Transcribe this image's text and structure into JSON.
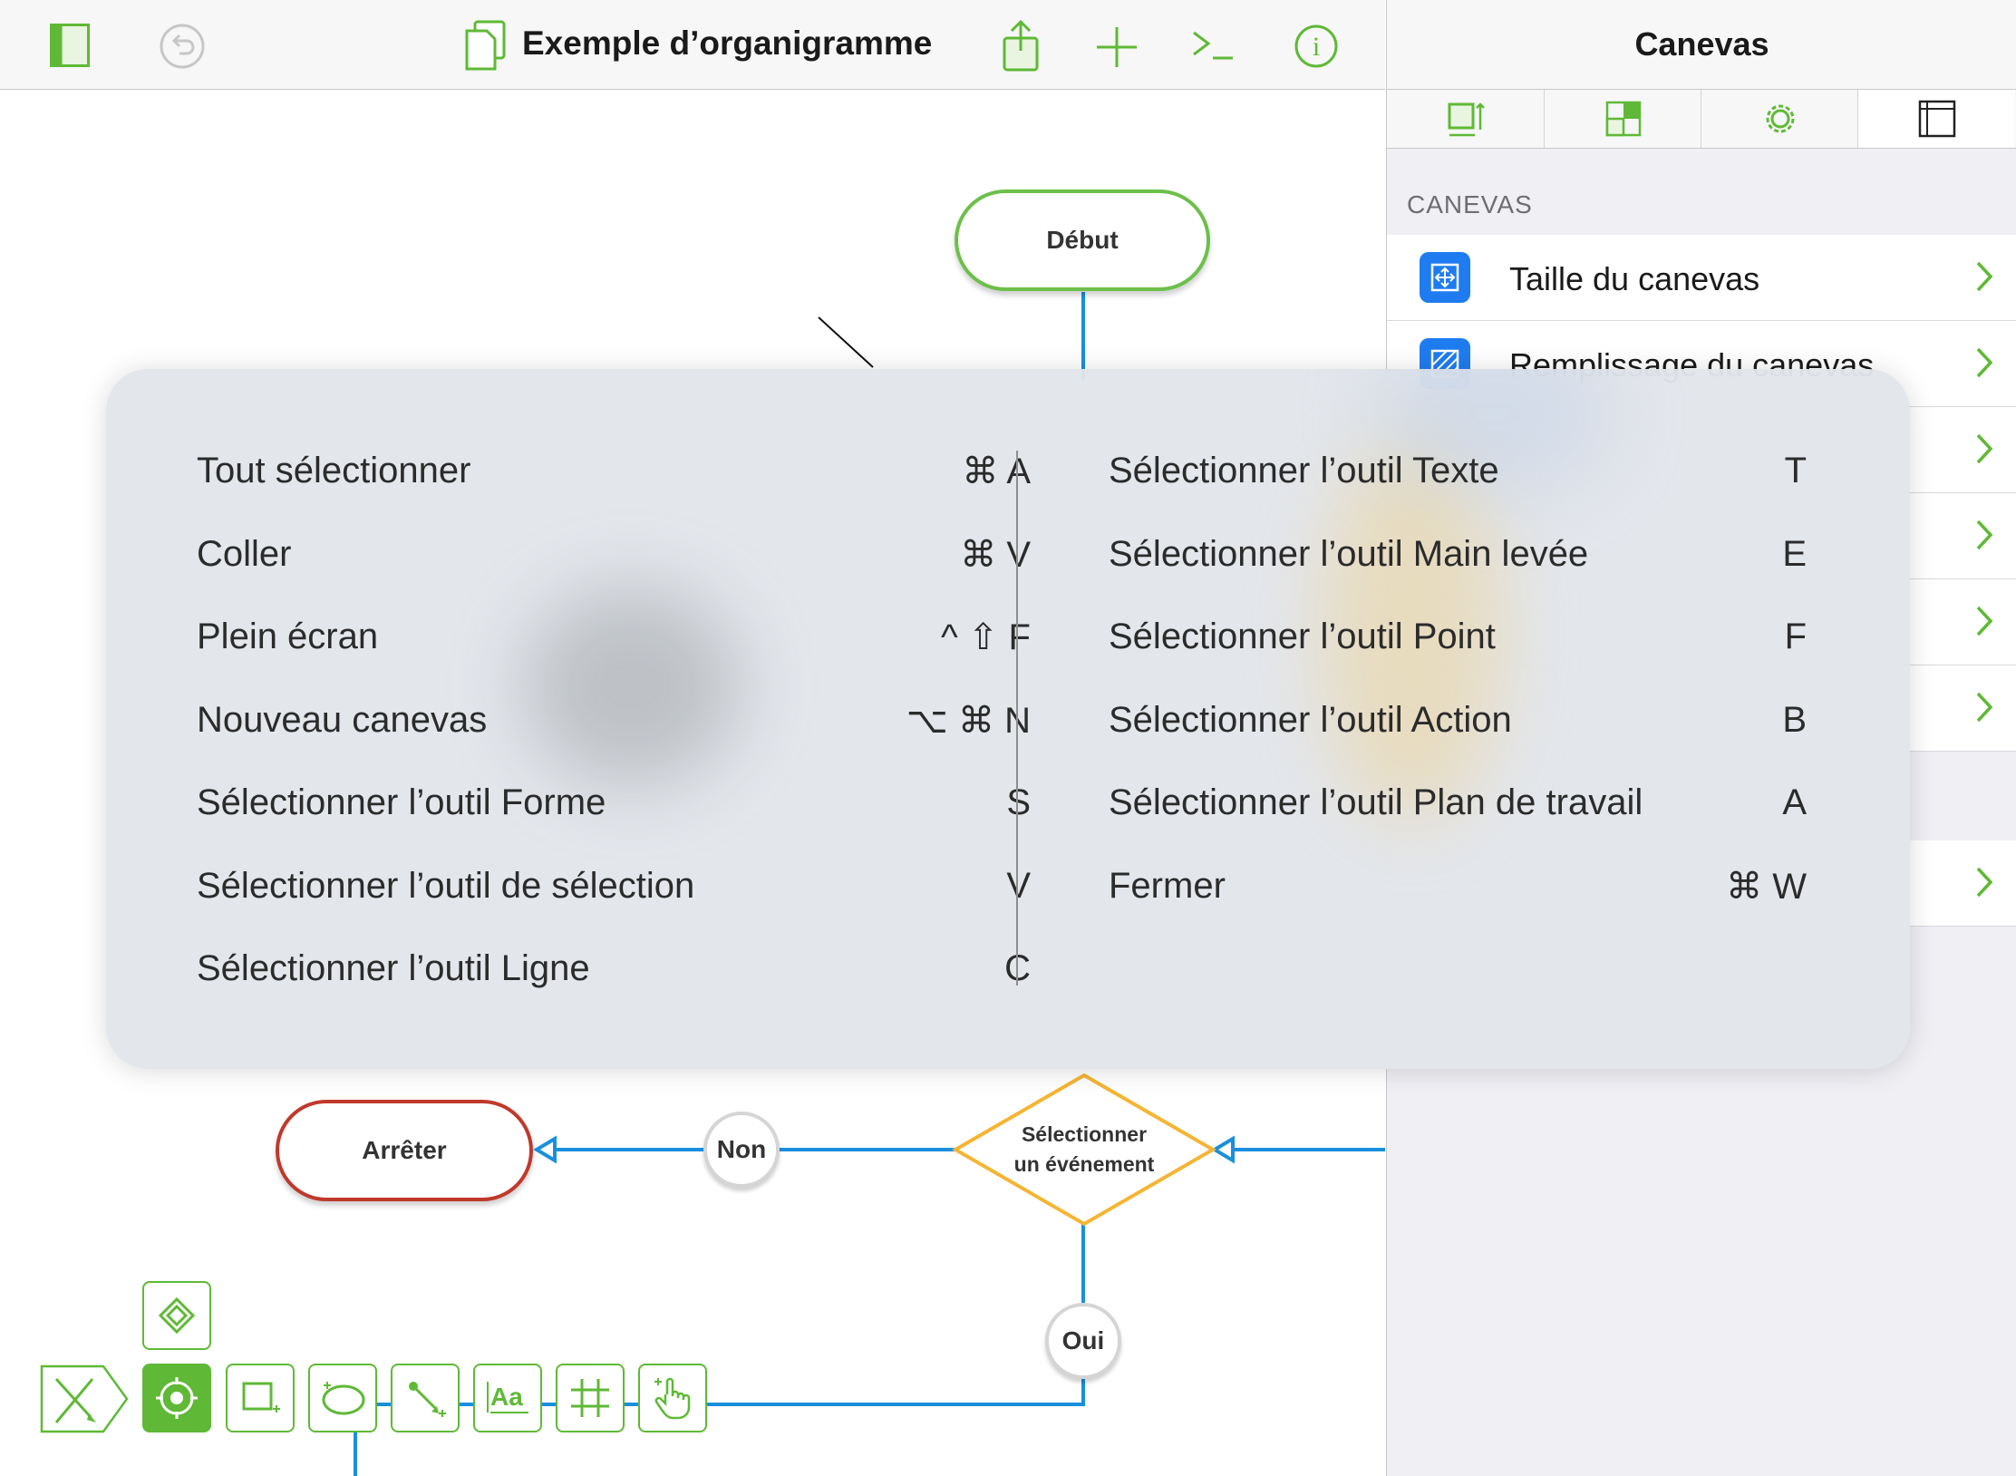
{
  "toolbar": {
    "document_title": "Exemple d’organigramme",
    "icons": [
      "sidebar-icon",
      "undo-icon",
      "document-icon",
      "share-icon",
      "add-icon",
      "console-icon",
      "info-icon"
    ]
  },
  "diagram": {
    "start_label": "Début",
    "stop_label": "Arrêter",
    "no_label": "Non",
    "yes_label": "Oui",
    "decision_line1": "Sélectionner",
    "decision_line2": "un événement",
    "colors": {
      "start": "#6cc04a",
      "stop": "#c0392b",
      "decision": "#f5b533",
      "connector": "#1a8fdd"
    }
  },
  "inspector": {
    "title": "Canevas",
    "tabs": [
      "canvas-size-tab",
      "grid-tab",
      "settings-tab",
      "canvas-tab"
    ],
    "section_label": "CANEVAS",
    "rows": [
      {
        "label": "Taille du canevas",
        "icon": "canvas-size-icon"
      },
      {
        "label": "Remplissage du canevas",
        "icon": "canvas-fill-icon"
      }
    ]
  },
  "shortcuts": {
    "left": [
      {
        "label": "Tout sélectionner",
        "keys": "⌘ A"
      },
      {
        "label": "Coller",
        "keys": "⌘ V"
      },
      {
        "label": "Plein écran",
        "keys": "^ ⇧ F"
      },
      {
        "label": "Nouveau canevas",
        "keys": "⌥ ⌘ N"
      },
      {
        "label": "Sélectionner l’outil Forme",
        "keys": "S"
      },
      {
        "label": "Sélectionner l’outil de sélection",
        "keys": "V"
      },
      {
        "label": "Sélectionner l’outil Ligne",
        "keys": "C"
      }
    ],
    "right": [
      {
        "label": "Sélectionner l’outil Texte",
        "keys": "T"
      },
      {
        "label": "Sélectionner l’outil Main levée",
        "keys": "E"
      },
      {
        "label": "Sélectionner l’outil Point",
        "keys": "F"
      },
      {
        "label": "Sélectionner l’outil Action",
        "keys": "B"
      },
      {
        "label": "Sélectionner l’outil Plan de travail",
        "keys": "A"
      },
      {
        "label": "Fermer",
        "keys": "⌘ W"
      }
    ]
  },
  "tools": [
    "pen-tool",
    "point-tool",
    "shape-tool",
    "lasso-tool",
    "line-tool",
    "text-tool",
    "artboard-tool",
    "action-tool",
    "diamond-tool"
  ],
  "colors": {
    "accent_green": "#5fb936",
    "blue_icon": "#1f7cf0"
  }
}
